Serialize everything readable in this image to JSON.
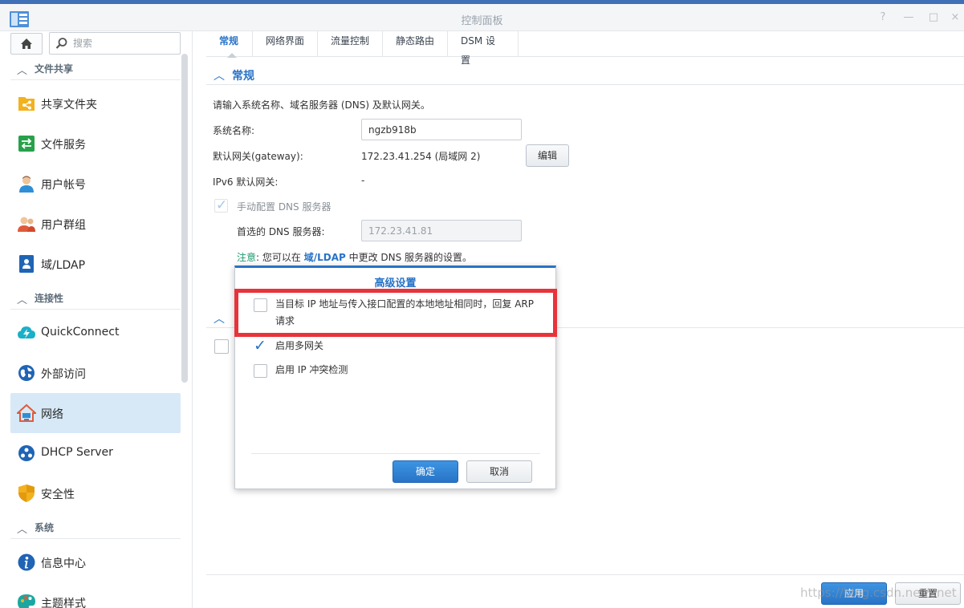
{
  "window": {
    "title": "控制面板",
    "controls": [
      "?",
      "—",
      "□",
      "×"
    ]
  },
  "search": {
    "placeholder": "搜索"
  },
  "sidebar": {
    "sections": [
      {
        "label": "文件共享"
      },
      {
        "label": "连接性"
      },
      {
        "label": "系统"
      }
    ],
    "items": [
      {
        "label": "共享文件夹",
        "icon": "shared-folder-icon"
      },
      {
        "label": "文件服务",
        "icon": "file-services-icon"
      },
      {
        "label": "用户帐号",
        "icon": "user-icon"
      },
      {
        "label": "用户群组",
        "icon": "group-icon"
      },
      {
        "label": "域/LDAP",
        "icon": "domain-ldap-icon"
      },
      {
        "label": "QuickConnect",
        "icon": "quickconnect-icon"
      },
      {
        "label": "外部访问",
        "icon": "external-access-icon"
      },
      {
        "label": "网络",
        "icon": "network-home-icon",
        "active": true
      },
      {
        "label": "DHCP Server",
        "icon": "dhcp-icon"
      },
      {
        "label": "安全性",
        "icon": "security-shield-icon"
      },
      {
        "label": "信息中心",
        "icon": "info-icon"
      },
      {
        "label": "主题样式",
        "icon": "theme-palette-icon"
      }
    ]
  },
  "tabs": [
    {
      "label": "常规",
      "active": true
    },
    {
      "label": "网络界面"
    },
    {
      "label": "流量控制"
    },
    {
      "label": "静态路由"
    },
    {
      "label": "DSM 设置"
    }
  ],
  "general": {
    "section_title": "常规",
    "description": "请输入系统名称、域名服务器 (DNS) 及默认网关。",
    "server_name_label": "系统名称:",
    "server_name_value": "ngzb918b",
    "gateway_label": "默认网关(gateway):",
    "gateway_value": "172.23.41.254 (局域网 2)",
    "edit_button": "编辑",
    "ipv6_label": "IPv6 默认网关:",
    "ipv6_value": "-",
    "manual_dns_label": "手动配置 DNS 服务器",
    "preferred_dns_label": "首选的 DNS 服务器:",
    "preferred_dns_value": "172.23.41.81",
    "note_label": "注意",
    "note_pre": ": 您可以在 ",
    "note_link": "域/LDAP",
    "note_post": " 中更改 DNS 服务器的设置。"
  },
  "dialog": {
    "title": "高级设置",
    "options": [
      {
        "label_line1": "当目标 IP 地址与传入接口配置的本地地址相同时，回复 ARP",
        "label_line2": "请求",
        "checked": false
      },
      {
        "label": "启用多网关",
        "checked": true
      },
      {
        "label": "启用 IP 冲突检测",
        "checked": false
      }
    ],
    "ok": "确定",
    "cancel": "取消"
  },
  "footer": {
    "apply": "应用",
    "reset": "重置"
  },
  "watermark": "https://blog.csdn.net/..net",
  "colors": {
    "accent": "#2873c7",
    "highlight_box": "#e8333b",
    "active_nav": "#d7e9f7"
  }
}
